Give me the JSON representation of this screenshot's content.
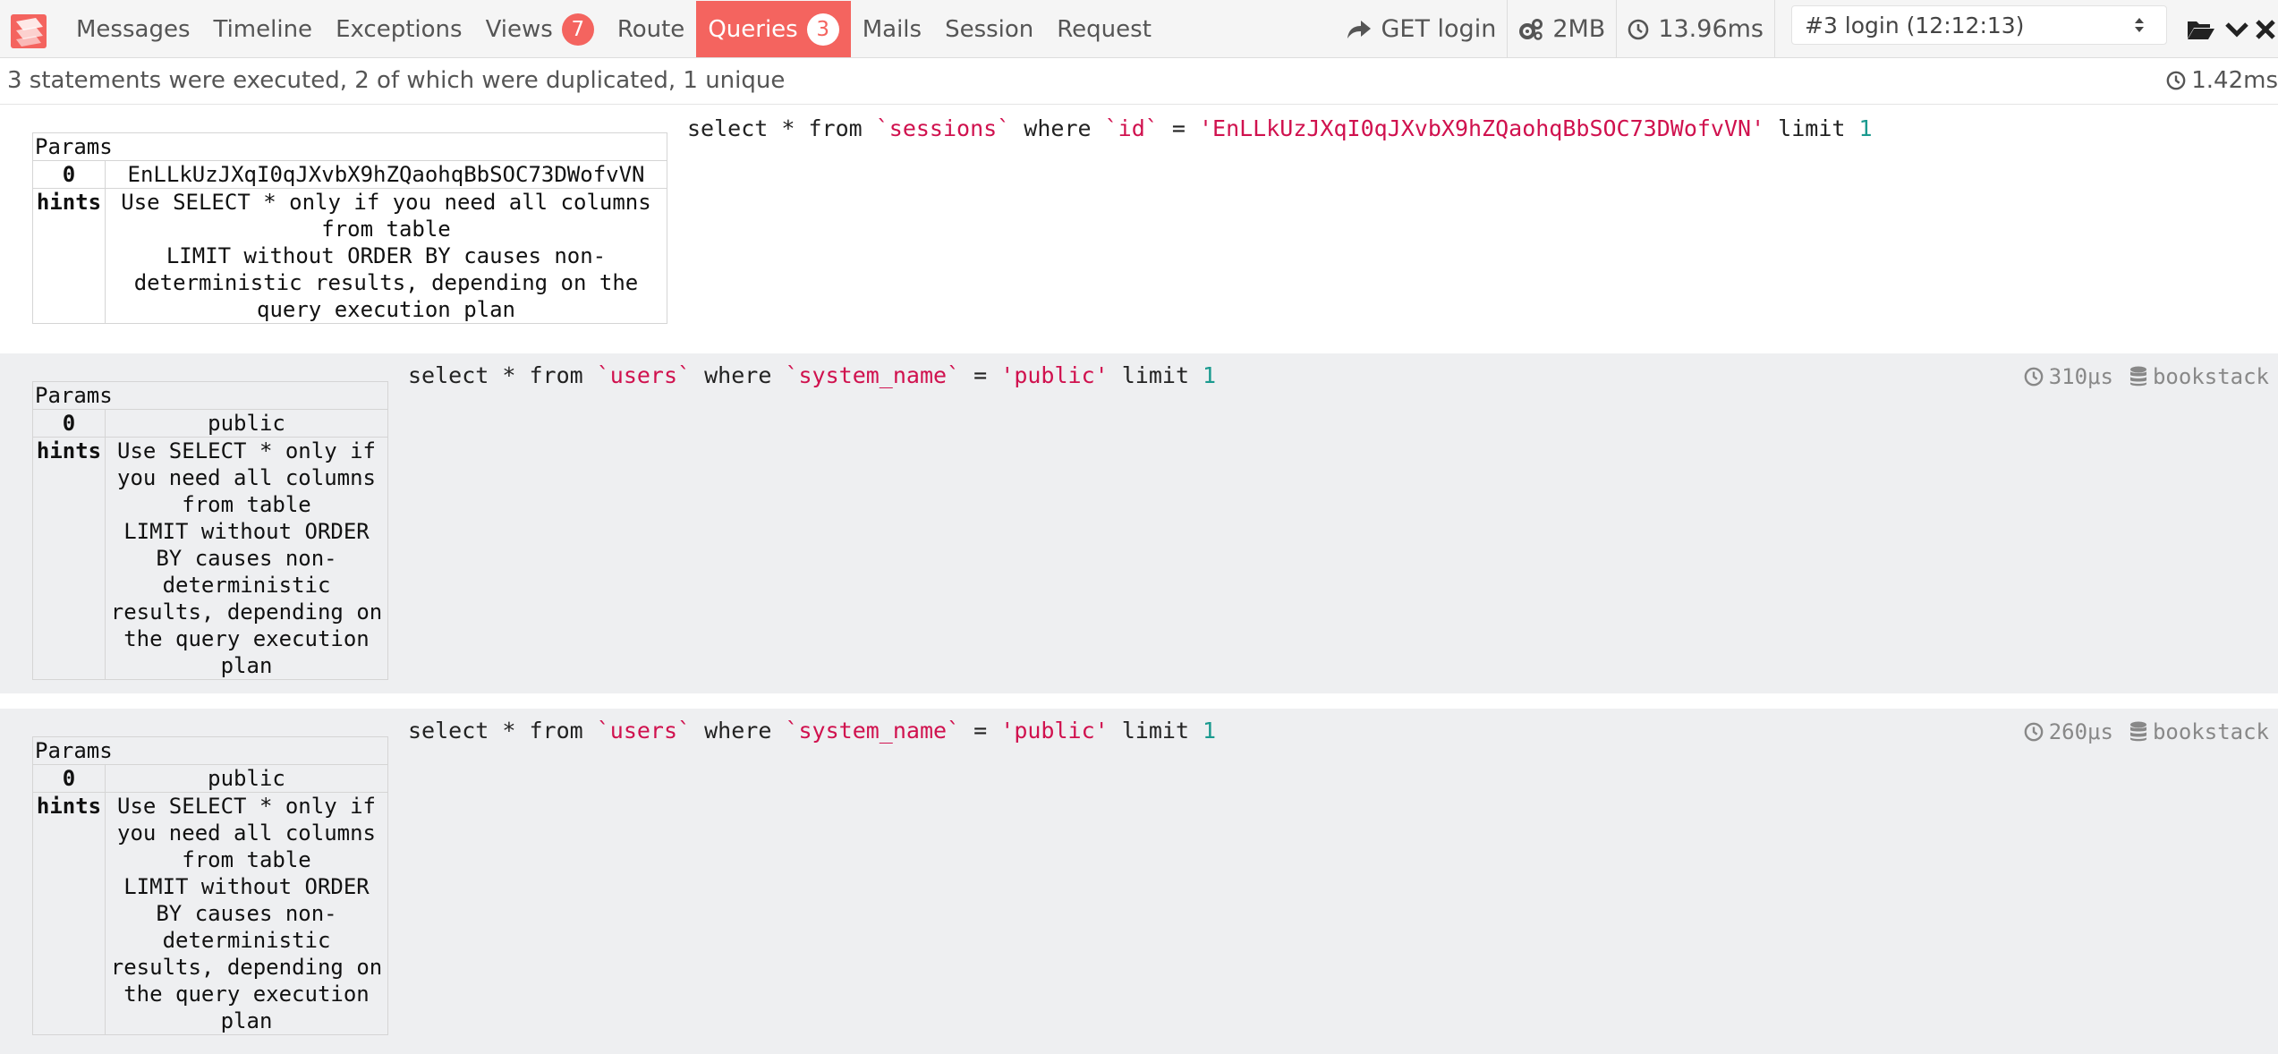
{
  "header": {
    "tabs": [
      {
        "label": "Messages"
      },
      {
        "label": "Timeline"
      },
      {
        "label": "Exceptions"
      },
      {
        "label": "Views",
        "badge": "7"
      },
      {
        "label": "Route"
      },
      {
        "label": "Queries",
        "badge": "3",
        "active": true
      },
      {
        "label": "Mails"
      },
      {
        "label": "Session"
      },
      {
        "label": "Request"
      }
    ],
    "request": "GET login",
    "memory": "2MB",
    "duration": "13.96ms",
    "selected_request": "#3 login (12:12:13)"
  },
  "summary": {
    "text": "3 statements were executed, 2 of which were duplicated, 1 unique",
    "duration": "1.42ms"
  },
  "params_caption": "Params",
  "hints_key": "hints",
  "statements": [
    {
      "sql": {
        "p1": "select * from ",
        "table": "`sessions`",
        "p2": " where ",
        "column": "`id`",
        "p3": " = ",
        "value": "'EnLLkUzJXqI0qJXvbX9hZQaohqBbSOC73DWofvVN'",
        "p4": " limit ",
        "limit": "1"
      },
      "param_key": "0",
      "param_value": "EnLLkUzJXqI0qJXvbX9hZQaohqBbSOC73DWofvVN",
      "hints": [
        "Use SELECT * only if you need all columns from table",
        "LIMIT without ORDER BY causes non-deterministic results, depending on the query execution plan"
      ]
    },
    {
      "sql": {
        "p1": "select * from ",
        "table": "`users`",
        "p2": " where ",
        "column": "`system_name`",
        "p3": " = ",
        "value": "'public'",
        "p4": " limit ",
        "limit": "1"
      },
      "duration": "310μs",
      "connection": "bookstack",
      "param_key": "0",
      "param_value": "public",
      "hints": [
        "Use SELECT * only if you need all columns from table",
        "LIMIT without ORDER BY causes non-deterministic results, depending on the query execution plan"
      ]
    },
    {
      "sql": {
        "p1": "select * from ",
        "table": "`users`",
        "p2": " where ",
        "column": "`system_name`",
        "p3": " = ",
        "value": "'public'",
        "p4": " limit ",
        "limit": "1"
      },
      "duration": "260μs",
      "connection": "bookstack",
      "param_key": "0",
      "param_value": "public",
      "hints": [
        "Use SELECT * only if you need all columns from table",
        "LIMIT without ORDER BY causes non-deterministic results, depending on the query execution plan"
      ]
    }
  ],
  "colors": {
    "accent": "#f4645f",
    "sql_identifier": "#d0114e",
    "sql_number": "#1a9a8f",
    "row_alt_bg": "#eeeff1"
  }
}
